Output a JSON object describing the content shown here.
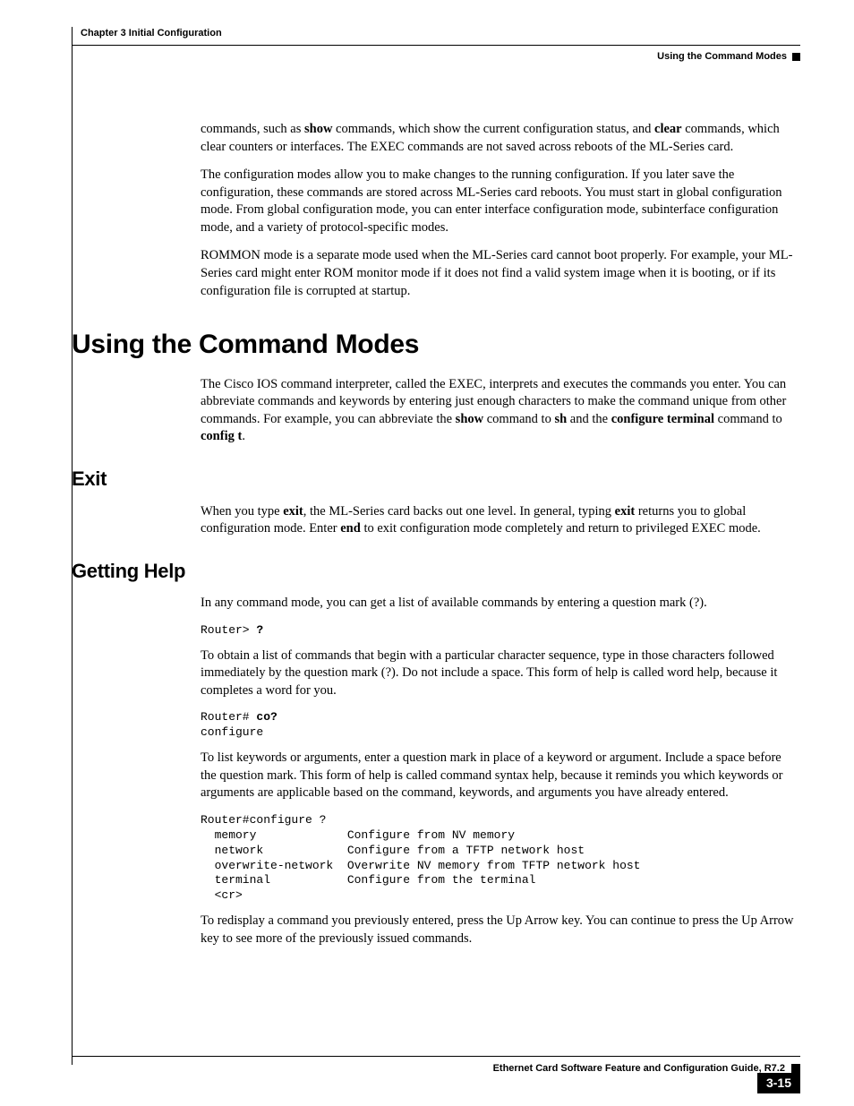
{
  "header": {
    "chapter": "Chapter 3    Initial Configuration",
    "section": "Using the Command Modes"
  },
  "intro": {
    "p1a": "commands, such as ",
    "p1b": "show",
    "p1c": " commands, which show the current configuration status, and ",
    "p1d": "clear",
    "p1e": " commands, which clear counters or interfaces. The EXEC commands are not saved across reboots of the ML-Series card.",
    "p2": "The configuration modes allow you to make changes to the running configuration. If you later save the configuration, these commands are stored across ML-Series card reboots. You must start in global configuration mode. From global configuration mode, you can enter interface configuration mode, subinterface configuration mode, and a variety of protocol-specific modes.",
    "p3": "ROMMON mode is a separate mode used when the ML-Series card cannot boot properly. For example, your ML-Series card might enter ROM monitor mode if it does not find a valid system image when it is booting, or if its configuration file is corrupted at startup."
  },
  "h1": "Using the Command Modes",
  "using": {
    "p1a": "The Cisco IOS command interpreter, called the EXEC, interprets and executes the commands you enter. You can abbreviate commands and keywords by entering just enough characters to make the command unique from other commands. For example, you can abbreviate the ",
    "p1b": "show",
    "p1c": " command to ",
    "p1d": "sh",
    "p1e": " and the ",
    "p1f": "configure terminal",
    "p1g": " command to ",
    "p1h": "config t",
    "p1i": "."
  },
  "exit": {
    "h2": "Exit",
    "p1a": "When you type ",
    "p1b": "exit",
    "p1c": ", the ML-Series card backs out one level. In general, typing ",
    "p1d": "exit",
    "p1e": " returns you to global configuration mode. Enter ",
    "p1f": "end",
    "p1g": " to exit configuration mode completely and return to privileged EXEC mode."
  },
  "help": {
    "h2": "Getting Help",
    "p1": "In any command mode, you can get a list of available commands by entering a question mark (?).",
    "code1a": "Router> ",
    "code1b": "?",
    "p2": "To obtain a list of commands that begin with a particular character sequence, type in those characters followed immediately by the question mark (?). Do not include a space. This form of help is called word help, because it completes a word for you.",
    "code2a": "Router# ",
    "code2b": "co?",
    "code2c": "\nconfigure",
    "p3": "To list keywords or arguments, enter a question mark in place of a keyword or argument. Include a space before the question mark. This form of help is called command syntax help, because it reminds you which keywords or arguments are applicable based on the command, keywords, and arguments you have already entered.",
    "code3": "Router#configure ?\n  memory             Configure from NV memory\n  network            Configure from a TFTP network host\n  overwrite-network  Overwrite NV memory from TFTP network host\n  terminal           Configure from the terminal\n  <cr>",
    "p4": "To redisplay a command you previously entered, press the Up Arrow key. You can continue to press the Up Arrow key to see more of the previously issued commands."
  },
  "footer": {
    "title": "Ethernet Card Software Feature and Configuration Guide, R7.2",
    "page": "3-15"
  }
}
